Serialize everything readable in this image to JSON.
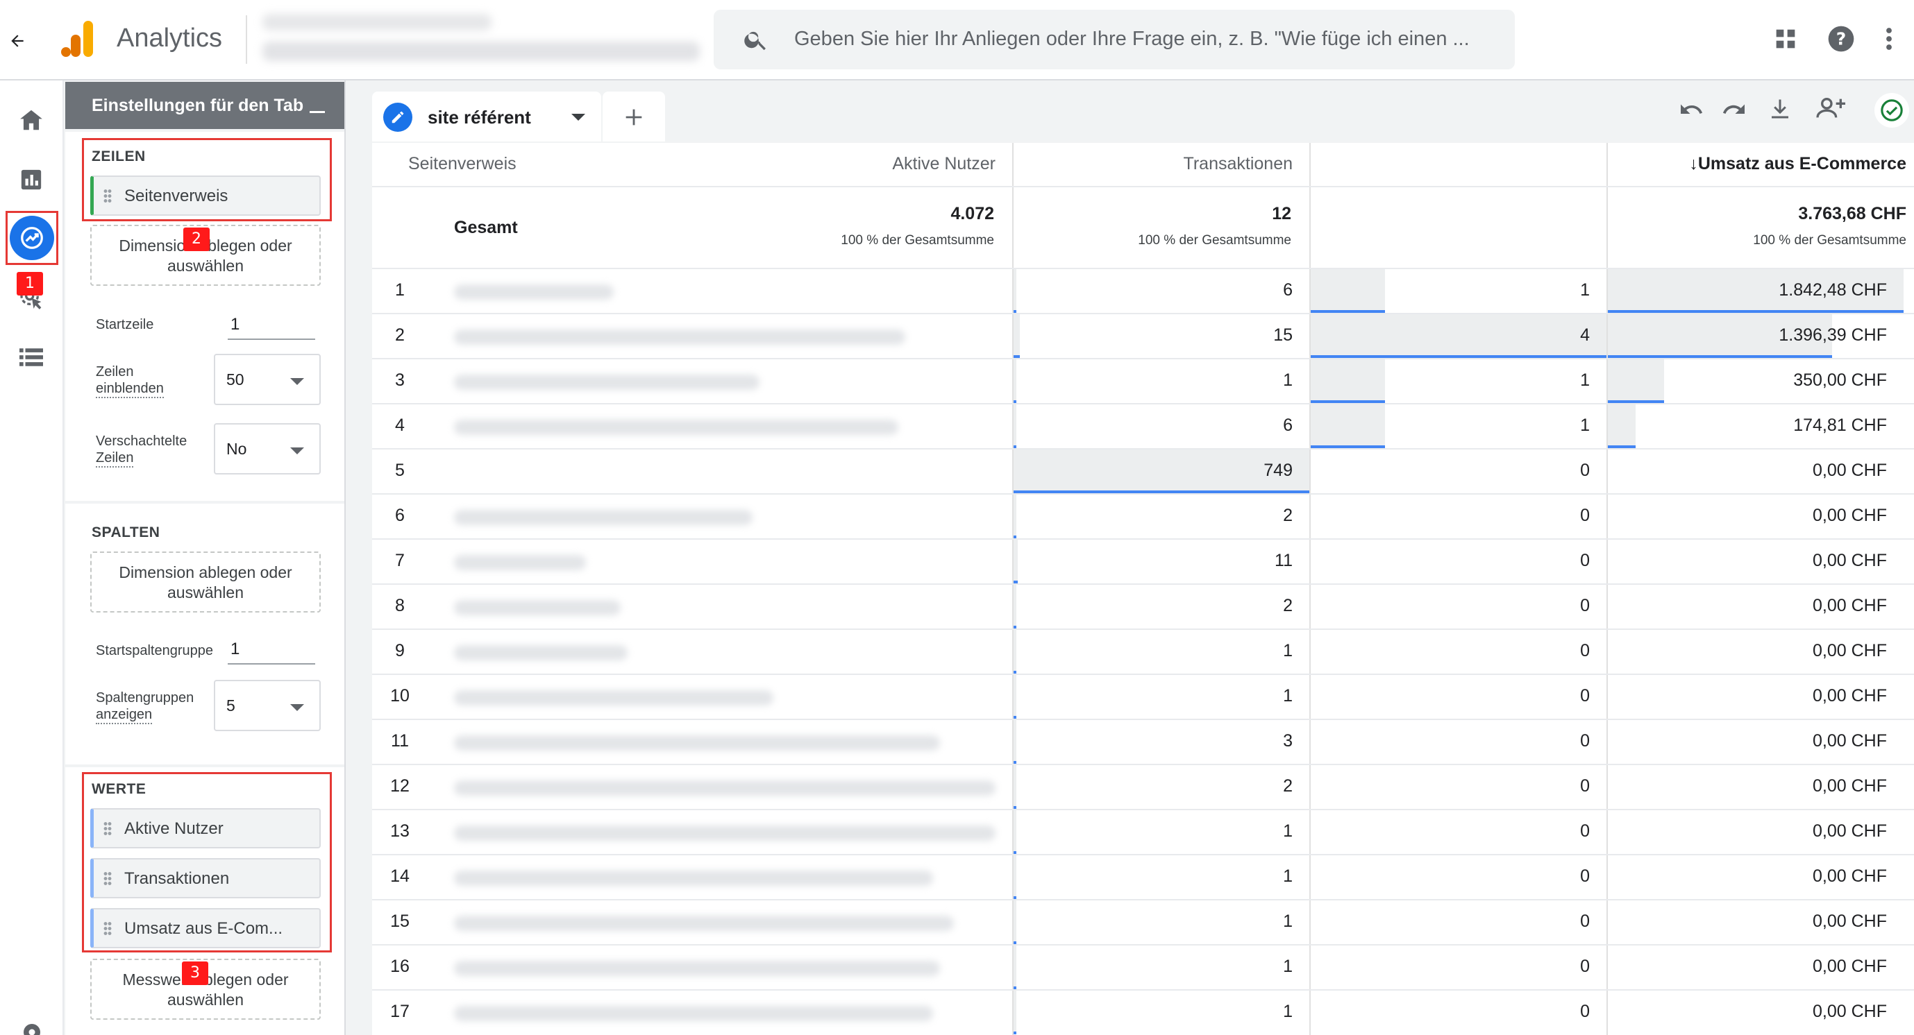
{
  "app": {
    "title": "Analytics",
    "back_icon": "arrow-back-icon",
    "logo_icon": "analytics-logo-icon"
  },
  "search": {
    "placeholder": "Geben Sie hier Ihr Anliegen oder Ihre Frage ein, z. B. \"Wie füge ich einen ..."
  },
  "nav": [
    "home-icon",
    "reports-icon",
    "explore-icon",
    "advertising-icon",
    "configure-icon"
  ],
  "settings": {
    "header": "Einstellungen für den Tab",
    "rows_title": "ZEILEN",
    "rows_dimension": "Seitenverweis",
    "drop_dimension": "Dimension ablegen oder auswählen",
    "start_row_label": "Startzeile",
    "start_row_value": "1",
    "show_rows_label_1": "Zeilen",
    "show_rows_label_2": "einblenden",
    "show_rows_value": "50",
    "nested_rows_label_1": "Verschachtelte",
    "nested_rows_label_2": "Zeilen",
    "nested_rows_value": "No",
    "columns_title": "SPALTEN",
    "start_colgroup_label": "Startspaltengruppe",
    "start_colgroup_value": "1",
    "show_colgroups_label_1": "Spaltengruppen",
    "show_colgroups_label_2": "anzeigen",
    "show_colgroups_value": "5",
    "values_title": "WERTE",
    "values": [
      "Aktive Nutzer",
      "Transaktionen",
      "Umsatz aus E-Com..."
    ],
    "drop_metric": "Messwert ablegen oder auswählen"
  },
  "annotations": [
    "1",
    "2",
    "3"
  ],
  "tab": {
    "label": "site référent"
  },
  "table": {
    "headers": [
      "Seitenverweis",
      "Aktive Nutzer",
      "Transaktionen",
      "↓Umsatz aus E-Commerce"
    ],
    "total_label": "Gesamt",
    "totals": [
      "4.072",
      "12",
      "3.763,68 CHF"
    ],
    "total_pct": "100 % der Gesamtsumme",
    "rows": [
      {
        "n": "1",
        "users": "6",
        "trans": "1",
        "rev": "1.842,48 CHF"
      },
      {
        "n": "2",
        "users": "15",
        "trans": "4",
        "rev": "1.396,39 CHF"
      },
      {
        "n": "3",
        "users": "1",
        "trans": "1",
        "rev": "350,00 CHF"
      },
      {
        "n": "4",
        "users": "6",
        "trans": "1",
        "rev": "174,81 CHF"
      },
      {
        "n": "5",
        "users": "749",
        "trans": "0",
        "rev": "0,00 CHF"
      },
      {
        "n": "6",
        "users": "2",
        "trans": "0",
        "rev": "0,00 CHF"
      },
      {
        "n": "7",
        "users": "11",
        "trans": "0",
        "rev": "0,00 CHF"
      },
      {
        "n": "8",
        "users": "2",
        "trans": "0",
        "rev": "0,00 CHF"
      },
      {
        "n": "9",
        "users": "1",
        "trans": "0",
        "rev": "0,00 CHF"
      },
      {
        "n": "10",
        "users": "1",
        "trans": "0",
        "rev": "0,00 CHF"
      },
      {
        "n": "11",
        "users": "3",
        "trans": "0",
        "rev": "0,00 CHF"
      },
      {
        "n": "12",
        "users": "2",
        "trans": "0",
        "rev": "0,00 CHF"
      },
      {
        "n": "13",
        "users": "1",
        "trans": "0",
        "rev": "0,00 CHF"
      },
      {
        "n": "14",
        "users": "1",
        "trans": "0",
        "rev": "0,00 CHF"
      },
      {
        "n": "15",
        "users": "1",
        "trans": "0",
        "rev": "0,00 CHF"
      },
      {
        "n": "16",
        "users": "1",
        "trans": "0",
        "rev": "0,00 CHF"
      },
      {
        "n": "17",
        "users": "1",
        "trans": "0",
        "rev": "0,00 CHF"
      }
    ]
  },
  "colors": {
    "accent": "#1a73e8",
    "annotation": "#e53935",
    "bar": "#4285f4",
    "logo_orange": "#f9ab00",
    "logo_dark": "#e37400"
  }
}
